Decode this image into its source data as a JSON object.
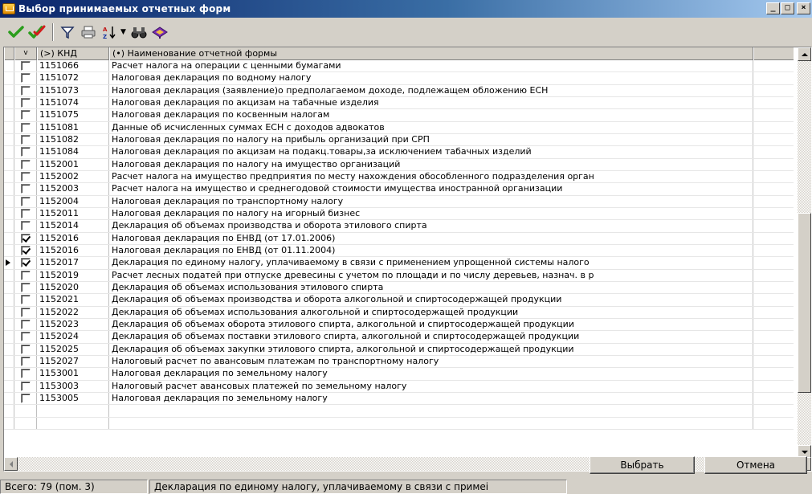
{
  "window": {
    "title": "Выбор принимаемых отчетных форм",
    "controls": {
      "minimize": "_",
      "maximize": "□",
      "close": "×"
    }
  },
  "toolbar": {
    "buttons": [
      {
        "icon": "check-green-icon"
      },
      {
        "icon": "check-double-icon"
      },
      {
        "icon": "filter-icon"
      },
      {
        "icon": "print-icon"
      },
      {
        "icon": "sort-az-icon"
      },
      {
        "icon": "binoculars-icon"
      },
      {
        "icon": "book-icon"
      }
    ]
  },
  "grid": {
    "columns": [
      "",
      "(>) КНД",
      "(•) Наименование отчетной формы"
    ],
    "header_check_symbol": "v",
    "rows": [
      {
        "checked": false,
        "code": "1151066",
        "name": "Расчет налога на операции с ценными бумагами"
      },
      {
        "checked": false,
        "code": "1151072",
        "name": "Налоговая декларация по водному налогу"
      },
      {
        "checked": false,
        "code": "1151073",
        "name": "Налоговая декларация (заявление)о предполагаемом доходе, подлежащем обложению ЕСН"
      },
      {
        "checked": false,
        "code": "1151074",
        "name": "Налоговая декларация по акцизам на табачные изделия"
      },
      {
        "checked": false,
        "code": "1151075",
        "name": "Налоговая декларация по косвенным налогам"
      },
      {
        "checked": false,
        "code": "1151081",
        "name": "Данные об исчисленных суммах  ЕСН с доходов адвокатов"
      },
      {
        "checked": false,
        "code": "1151082",
        "name": "Налоговая декларация по налогу на прибыль организаций при СРП"
      },
      {
        "checked": false,
        "code": "1151084",
        "name": "Налоговая декларация по акцизам на подакц.товары,за исключением табачных изделий"
      },
      {
        "checked": false,
        "code": "1152001",
        "name": "Налоговая декларация по налогу на имущество организаций"
      },
      {
        "checked": false,
        "code": "1152002",
        "name": "Расчет налога на имущество предприятия по месту нахождения обособленного подразделения орган"
      },
      {
        "checked": false,
        "code": "1152003",
        "name": "Расчет налога на имущество и среднегодовой стоимости имущества иностранной организации"
      },
      {
        "checked": false,
        "code": "1152004",
        "name": "Налоговая декларация по транспортному налогу"
      },
      {
        "checked": false,
        "code": "1152011",
        "name": "Налоговая декларация по налогу на игорный бизнес"
      },
      {
        "checked": false,
        "code": "1152014",
        "name": "Декларация об объемах производства и оборота этилового спирта"
      },
      {
        "checked": true,
        "code": "1152016",
        "name": "Налоговая декларация по ЕНВД (от 17.01.2006)"
      },
      {
        "checked": true,
        "code": "1152016",
        "name": "Налоговая декларация по ЕНВД (от 01.11.2004)"
      },
      {
        "checked": true,
        "code": "1152017",
        "name": "Декларация по единому налогу, уплачиваемому в связи с применением упрощенной системы налого",
        "current": true
      },
      {
        "checked": false,
        "code": "1152019",
        "name": "Расчет лесных податей при отпуске древесины с учетом по площади и по числу деревьев, назнач. в р"
      },
      {
        "checked": false,
        "code": "1152020",
        "name": "Декларация об объемах использования этилового спирта"
      },
      {
        "checked": false,
        "code": "1152021",
        "name": "Декларация об объемах производства и оборота алкогольной и спиртосодержащей продукции"
      },
      {
        "checked": false,
        "code": "1152022",
        "name": "Декларация об объемах использования алкогольной и спиртосодержащей продукции"
      },
      {
        "checked": false,
        "code": "1152023",
        "name": "Декларация об объемах оборота этилового спирта, алкогольной и спиртосодержащей продукции"
      },
      {
        "checked": false,
        "code": "1152024",
        "name": "Декларация об объемах поставки этилового спирта, алкогольной и спиртосодержащей продукции"
      },
      {
        "checked": false,
        "code": "1152025",
        "name": "Декларация об объемах закупки этилового спирта, алкогольной и спиртосодержащей продукции"
      },
      {
        "checked": false,
        "code": "1152027",
        "name": "Налоговый расчет по авансовым платежам по транспортному налогу"
      },
      {
        "checked": false,
        "code": "1153001",
        "name": "Налоговая декларация по земельному налогу"
      },
      {
        "checked": false,
        "code": "1153003",
        "name": "Налоговый расчет авансовых платежей по земельному налогу"
      },
      {
        "checked": false,
        "code": "1153005",
        "name": "Налоговая декларация по земельному налогу"
      }
    ]
  },
  "buttons": {
    "select": "Выбрать",
    "cancel": "Отмена"
  },
  "status": {
    "total": "Всего: 79 (пом. 3)",
    "current": "Декларация по единому налогу, уплачиваемому в связи с примеі"
  }
}
